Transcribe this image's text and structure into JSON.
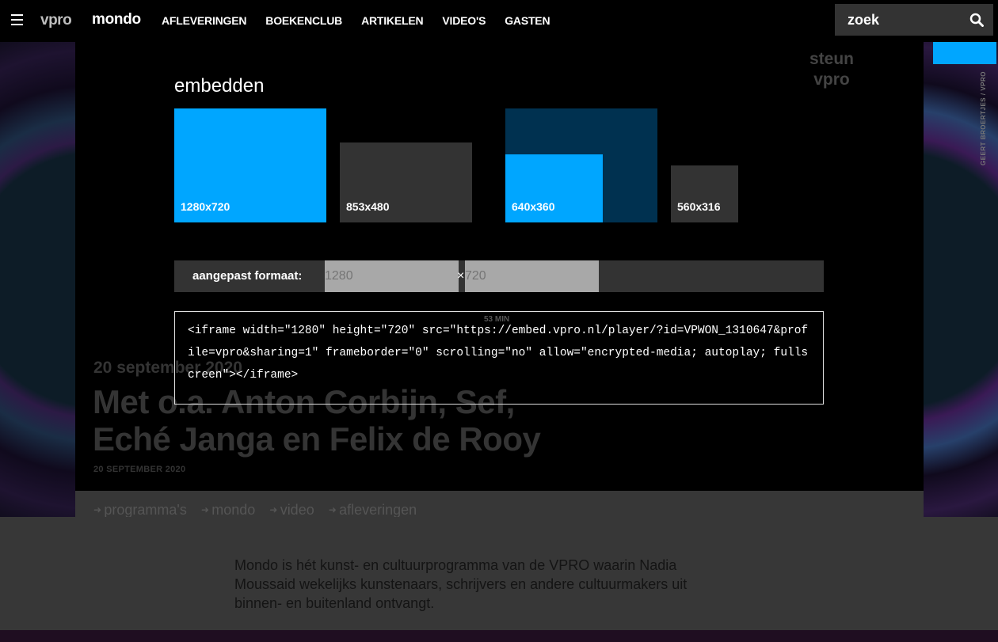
{
  "nav": {
    "brand_vpro": "vpro",
    "brand_mondo": "mondo",
    "items": [
      "AFLEVERINGEN",
      "BOEKENCLUB",
      "ARTIKELEN",
      "VIDEO'S",
      "GASTEN"
    ]
  },
  "search": {
    "placeholder": "zoek"
  },
  "background": {
    "steun_line1": "steun",
    "steun_line2": "vpro",
    "credit": "GEERT BROERTJES / VPRO",
    "date": "20 september 2020",
    "title_line1": "Met o.a. Anton Corbijn, Sef,",
    "title_line2": "Eché Janga en Felix de Rooy",
    "subdate": "20 SEPTEMBER 2020",
    "crumbs": [
      "programma's",
      "mondo",
      "video",
      "afleveringen"
    ],
    "description": "Mondo is hét kunst- en cultuurprogramma van de VPRO waarin Nadia Moussaid wekelijks kunstenaars, schrijvers en andere cultuurmakers uit binnen- en buitenland ontvangt.",
    "duration": "53 MIN"
  },
  "embed": {
    "title": "embedden",
    "sizes": [
      {
        "label": "1280x720"
      },
      {
        "label": "853x480"
      },
      {
        "label": "640x360"
      },
      {
        "label": "560x316"
      }
    ],
    "custom_label": "aangepast formaat:",
    "width_placeholder": "1280",
    "height_placeholder": "720",
    "times": "×",
    "code": "<iframe width=\"1280\" height=\"720\" src=\"https://embed.vpro.nl/player/?id=VPWON_1310647&profile=vpro&sharing=1\" frameborder=\"0\" scrolling=\"no\" allow=\"encrypted-media; autoplay; fullscreen\"></iframe>"
  },
  "colors": {
    "accent": "#00a6ff",
    "selected_frame": "#003150",
    "panel": "#333333"
  }
}
